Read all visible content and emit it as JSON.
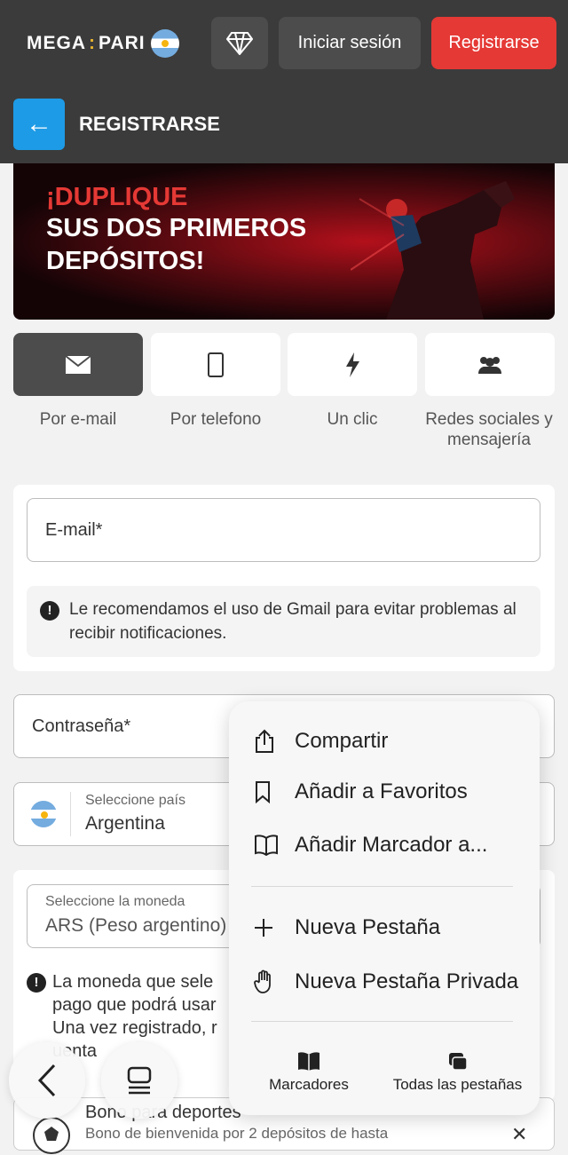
{
  "header": {
    "logo_left": "MEGA",
    "logo_colon": ":",
    "logo_right": "PARI",
    "login_label": "Iniciar sesión",
    "register_label": "Registrarse"
  },
  "subheader": {
    "back_arrow": "←",
    "title": "REGISTRARSE"
  },
  "banner": {
    "line1": "¡DUPLIQUE",
    "line2": "SUS DOS PRIMEROS",
    "line3": "DEPÓSITOS!"
  },
  "reg_tabs": [
    {
      "label": "Por e-mail",
      "icon": "envelope-icon",
      "active": true
    },
    {
      "label": "Por telefono",
      "icon": "phone-icon",
      "active": false
    },
    {
      "label": "Un clic",
      "icon": "lightning-icon",
      "active": false
    },
    {
      "label": "Redes sociales y mensajería",
      "icon": "people-icon",
      "active": false
    }
  ],
  "form": {
    "email_placeholder": "E-mail*",
    "gmail_tip": "Le recomendamos el uso de Gmail para evitar problemas al recibir notificaciones.",
    "password_placeholder": "Contraseña*",
    "country_label": "Seleccione país",
    "country_value": "Argentina",
    "currency_label": "Seleccione la moneda",
    "currency_value": "ARS (Peso argentino)",
    "currency_note": "La moneda que sele pago que podrá usar Una vez registrado, ",
    "currency_note_line1": "La moneda que sele",
    "currency_note_line2": "pago que podrá usar",
    "currency_note_line3": "Una vez registrado, r",
    "currency_note_line4": "uenta",
    "bonus_title": "Bono para deportes",
    "bonus_desc": "Bono de bienvenida por 2 depósitos de hasta"
  },
  "context_menu": {
    "items": [
      {
        "label": "Compartir",
        "icon": "share-icon"
      },
      {
        "label": "Añadir a Favoritos",
        "icon": "bookmark-icon"
      },
      {
        "label": "Añadir Marcador a...",
        "icon": "book-icon"
      },
      {
        "label": "Nueva Pestaña",
        "icon": "plus-icon"
      },
      {
        "label": "Nueva Pestaña Privada",
        "icon": "hand-icon"
      }
    ],
    "bookmarks_label": "Marcadores",
    "all_tabs_label": "Todas las pestañas"
  },
  "colors": {
    "header_bg": "#3b3b3b",
    "register_red": "#e53935",
    "back_blue": "#1e9be6",
    "logo_accent": "#e8b22e"
  }
}
